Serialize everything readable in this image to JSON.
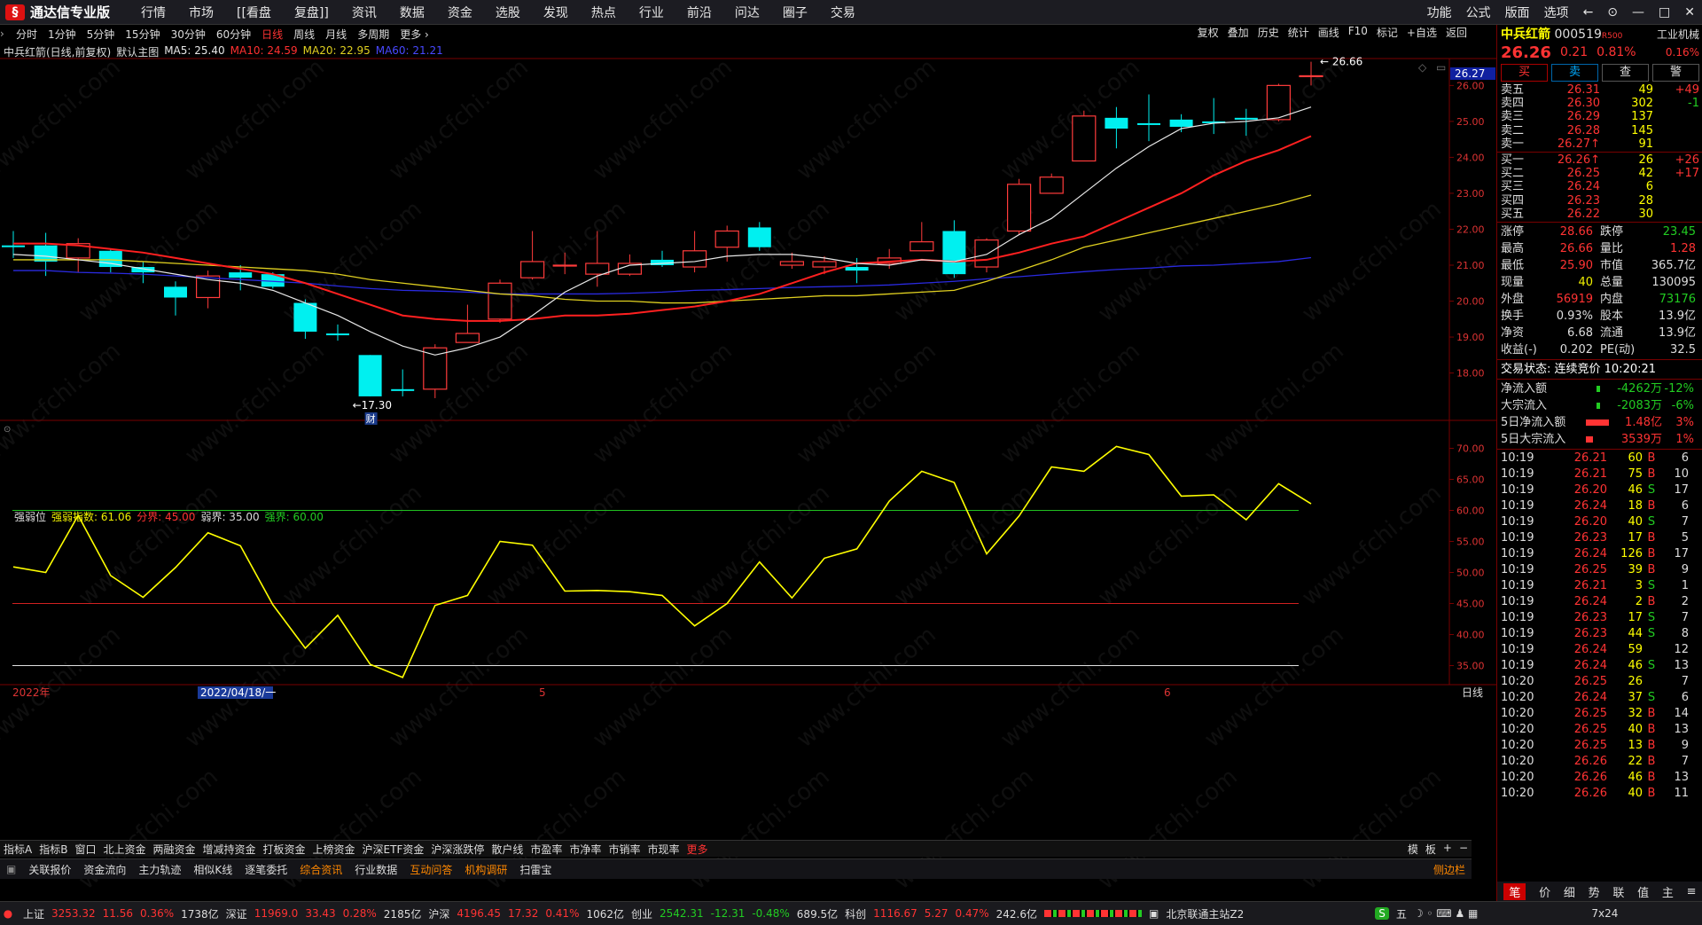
{
  "app": {
    "title": "通达信专业版"
  },
  "menu": [
    "行情",
    "市场",
    "[[看盘",
    "复盘]]",
    "资讯",
    "数据",
    "资金",
    "选股",
    "发现",
    "热点",
    "行业",
    "前沿",
    "问达",
    "圈子",
    "交易"
  ],
  "right_menu": [
    "功能",
    "公式",
    "版面",
    "选项",
    "←",
    "⊙",
    "—",
    "□",
    "✕"
  ],
  "periods": [
    "分时",
    "1分钟",
    "5分钟",
    "15分钟",
    "30分钟",
    "60分钟",
    "日线",
    "周线",
    "月线",
    "多周期",
    "更多 ›"
  ],
  "selected_period": "日线",
  "tools": [
    "复权",
    "叠加",
    "历史",
    "统计",
    "画线",
    "F10",
    "标记",
    "+自选",
    "返回"
  ],
  "ma_legend": {
    "stock": "中兵红箭(日线,前复权)",
    "main": "默认主图",
    "ma5": "MA5: 25.40",
    "ma10": "MA10: 24.59",
    "ma20": "MA20: 22.95",
    "ma60": "MA60: 21.21"
  },
  "rsi_legend": {
    "name": "强弱位",
    "val": "强弱指数: 61.06",
    "fen": "分界: 45.00",
    "ruo": "弱界: 35.00",
    "qiang": "强界: 60.00"
  },
  "colors": {
    "up": "#ff3b3b",
    "down": "#00f0f0",
    "ma5": "#e8e8e8",
    "ma10": "#ff2020",
    "ma20": "#e0d020",
    "ma60": "#2a2ae0",
    "rsi": "#ffff00"
  },
  "chart_data": [
    {
      "type": "candlestick",
      "title": "中兵红箭(日线,前复权)",
      "ylim": [
        17.2,
        26.7
      ],
      "y_ticks": [
        "26.00",
        "25.00",
        "24.00",
        "23.00",
        "22.00",
        "21.00",
        "20.00",
        "19.00",
        "18.00"
      ],
      "current_price_label": "26.27",
      "high_label": "26.66",
      "low_label": "17.30",
      "note_label": "财",
      "x_labels": [
        "2022年",
        "2022/04/18/一",
        "5",
        "6"
      ],
      "candles": [
        [
          21.55,
          21.5,
          21.95,
          21.2
        ],
        [
          21.55,
          21.1,
          21.9,
          20.7
        ],
        [
          21.2,
          21.6,
          21.75,
          20.8
        ],
        [
          21.4,
          20.95,
          21.45,
          20.8
        ],
        [
          20.95,
          20.8,
          21.1,
          20.5
        ],
        [
          20.4,
          20.1,
          20.55,
          19.6
        ],
        [
          20.1,
          20.7,
          20.85,
          19.8
        ],
        [
          20.8,
          20.65,
          21.0,
          20.3
        ],
        [
          20.75,
          20.4,
          20.8,
          20.35
        ],
        [
          19.95,
          19.15,
          20.05,
          18.95
        ],
        [
          19.1,
          19.05,
          19.35,
          18.9
        ],
        [
          18.5,
          17.35,
          18.5,
          17.35
        ],
        [
          17.55,
          17.5,
          18.1,
          17.35
        ],
        [
          17.55,
          18.7,
          18.8,
          17.3
        ],
        [
          18.85,
          19.1,
          19.9,
          18.9
        ],
        [
          19.5,
          20.5,
          20.6,
          19.4
        ],
        [
          20.65,
          21.1,
          21.95,
          20.6
        ],
        [
          21.0,
          21.0,
          21.35,
          20.75
        ],
        [
          20.75,
          21.05,
          21.95,
          20.4
        ],
        [
          20.75,
          21.05,
          21.3,
          20.7
        ],
        [
          21.15,
          21.0,
          21.4,
          20.95
        ],
        [
          20.95,
          21.4,
          21.95,
          20.8
        ],
        [
          21.5,
          21.95,
          22.1,
          21.1
        ],
        [
          22.05,
          21.5,
          22.2,
          21.4
        ],
        [
          21.0,
          21.1,
          21.35,
          20.9
        ],
        [
          20.95,
          21.1,
          21.25,
          20.75
        ],
        [
          20.95,
          20.85,
          21.2,
          20.5
        ],
        [
          21.05,
          21.2,
          21.45,
          20.9
        ],
        [
          21.4,
          21.65,
          22.2,
          21.4
        ],
        [
          21.95,
          20.75,
          22.25,
          20.65
        ],
        [
          20.95,
          21.7,
          21.75,
          20.8
        ],
        [
          21.95,
          23.25,
          23.4,
          21.85
        ],
        [
          23.0,
          23.45,
          23.55,
          23.2
        ],
        [
          23.9,
          25.15,
          25.3,
          23.9
        ],
        [
          25.1,
          24.8,
          25.4,
          24.25
        ],
        [
          24.95,
          24.9,
          25.75,
          24.45
        ],
        [
          25.05,
          24.85,
          25.2,
          24.7
        ],
        [
          25.0,
          24.95,
          25.65,
          24.65
        ],
        [
          25.1,
          25.05,
          25.35,
          24.6
        ],
        [
          25.05,
          26.0,
          26.05,
          25.0
        ],
        [
          26.26,
          26.27,
          26.66,
          26.0
        ]
      ],
      "ma5": [
        21.3,
        21.25,
        21.15,
        21.05,
        20.9,
        20.75,
        20.6,
        20.5,
        20.3,
        19.95,
        19.6,
        19.15,
        18.75,
        18.5,
        18.7,
        19.0,
        19.6,
        20.25,
        20.7,
        21.0,
        21.05,
        21.1,
        21.25,
        21.3,
        21.3,
        21.2,
        21.05,
        21.0,
        21.15,
        21.1,
        21.3,
        21.85,
        22.3,
        23.0,
        23.7,
        24.3,
        24.8,
        24.95,
        25.0,
        25.1,
        25.4
      ],
      "ma10": [
        21.6,
        21.6,
        21.55,
        21.45,
        21.35,
        21.2,
        21.05,
        20.9,
        20.75,
        20.5,
        20.2,
        19.9,
        19.6,
        19.5,
        19.45,
        19.45,
        19.5,
        19.6,
        19.6,
        19.65,
        19.75,
        19.85,
        20.0,
        20.2,
        20.5,
        20.8,
        21.05,
        21.1,
        21.15,
        21.1,
        21.15,
        21.35,
        21.6,
        21.8,
        22.2,
        22.6,
        23.0,
        23.5,
        23.9,
        24.2,
        24.59
      ],
      "ma20": [
        21.15,
        21.15,
        21.15,
        21.15,
        21.1,
        21.05,
        21.0,
        20.95,
        20.9,
        20.85,
        20.75,
        20.6,
        20.5,
        20.4,
        20.3,
        20.2,
        20.15,
        20.05,
        20.0,
        20.0,
        19.95,
        19.95,
        20.0,
        20.05,
        20.1,
        20.15,
        20.15,
        20.2,
        20.25,
        20.3,
        20.55,
        20.85,
        21.15,
        21.5,
        21.7,
        21.9,
        22.1,
        22.3,
        22.5,
        22.7,
        22.95
      ],
      "ma60": [
        20.85,
        20.85,
        20.8,
        20.78,
        20.75,
        20.7,
        20.65,
        20.6,
        20.55,
        20.5,
        20.42,
        20.35,
        20.3,
        20.28,
        20.25,
        20.2,
        20.2,
        20.2,
        20.2,
        20.22,
        20.25,
        20.3,
        20.32,
        20.35,
        20.38,
        20.4,
        20.42,
        20.45,
        20.5,
        20.55,
        20.62,
        20.68,
        20.75,
        20.82,
        20.88,
        20.92,
        20.98,
        21.0,
        21.05,
        21.1,
        21.21
      ]
    },
    {
      "type": "line",
      "title": "强弱位",
      "ylim": [
        32.5,
        72.5
      ],
      "y_ticks": [
        "70.00",
        "65.00",
        "60.00",
        "55.00",
        "50.00",
        "45.00",
        "40.00",
        "35.00"
      ],
      "levels": [
        {
          "value": 60,
          "color": "#20c020"
        },
        {
          "value": 45,
          "color": "#d02020"
        },
        {
          "value": 35,
          "color": "#e0e0e0"
        }
      ],
      "values": [
        50.9,
        50.0,
        59.2,
        49.5,
        46.0,
        50.8,
        56.4,
        54.3,
        44.8,
        37.8,
        43.1,
        35.2,
        33.1,
        44.7,
        46.3,
        55.0,
        54.4,
        47.0,
        47.1,
        46.9,
        46.3,
        41.4,
        45.0,
        51.7,
        45.9,
        52.3,
        53.8,
        61.5,
        66.3,
        64.5,
        53.0,
        59.1,
        67.0,
        66.3,
        70.3,
        69.0,
        62.3,
        62.5,
        58.5,
        64.3,
        61.06
      ]
    }
  ],
  "tab_bar1": {
    "items": [
      "指标A",
      "指标B",
      "窗口",
      "北上资金",
      "两融资金",
      "增减持资金",
      "打板资金",
      "上榜资金",
      "沪深ETF资金",
      "沪深涨跌停",
      "散户线",
      "市盈率",
      "市净率",
      "市销率",
      "市现率",
      "更多"
    ],
    "right": [
      "模",
      "板",
      "+",
      "−"
    ]
  },
  "tab_bar2": {
    "items": [
      "关联报价",
      "资金流向",
      "主力轨迹",
      "相似K线",
      "逐笔委托",
      "综合资讯",
      "行业数据",
      "互动问答",
      "机构调研",
      "扫雷宝"
    ],
    "right": "侧边栏"
  },
  "period_label": "日线",
  "quote": {
    "name": "中兵红箭",
    "code": "000519",
    "tag": "R500",
    "industry": "工业机械",
    "price": "26.26",
    "change": "0.21",
    "pct": "0.81%",
    "right_pct": "0.16%",
    "buttons": [
      "买",
      "卖",
      "查",
      "警"
    ],
    "sells": [
      [
        "卖五",
        "26.31",
        "49",
        "+49"
      ],
      [
        "卖四",
        "26.30",
        "302",
        "-1"
      ],
      [
        "卖三",
        "26.29",
        "137",
        ""
      ],
      [
        "卖二",
        "26.28",
        "145",
        ""
      ],
      [
        "卖一",
        "26.27↑",
        "91",
        ""
      ]
    ],
    "buys": [
      [
        "买一",
        "26.26↑",
        "26",
        "+26"
      ],
      [
        "买二",
        "26.25",
        "42",
        "+17"
      ],
      [
        "买三",
        "26.24",
        "6",
        ""
      ],
      [
        "买四",
        "26.23",
        "28",
        ""
      ],
      [
        "买五",
        "26.22",
        "30",
        ""
      ]
    ],
    "info": [
      [
        "涨停",
        "28.66",
        "跌停",
        "23.45"
      ],
      [
        "最高",
        "26.66",
        "量比",
        "1.28"
      ],
      [
        "最低",
        "25.90",
        "市值",
        "365.7亿"
      ],
      [
        "现量",
        "40",
        "总量",
        "130095"
      ],
      [
        "外盘",
        "56919",
        "内盘",
        "73176"
      ],
      [
        "换手",
        "0.93%",
        "股本",
        "13.9亿"
      ],
      [
        "净资",
        "6.68",
        "流通",
        "13.9亿"
      ],
      [
        "收益(-)",
        "0.202",
        "PE(动)",
        "32.5"
      ]
    ],
    "status": "交易状态: 连续竞价 10:20:21",
    "flows": [
      [
        "净流入额",
        "-4262万",
        "-12%"
      ],
      [
        "大宗流入",
        "-2083万",
        "-6%"
      ],
      [
        "5日净流入额",
        "1.48亿",
        "3%"
      ],
      [
        "5日大宗流入",
        "3539万",
        "1%"
      ]
    ],
    "ticks": [
      [
        "10:19",
        "26.21",
        "60",
        "B",
        "6"
      ],
      [
        "10:19",
        "26.21",
        "75",
        "B",
        "10"
      ],
      [
        "10:19",
        "26.20",
        "46",
        "S",
        "17"
      ],
      [
        "10:19",
        "26.24",
        "18",
        "B",
        "6"
      ],
      [
        "10:19",
        "26.20",
        "40",
        "S",
        "7"
      ],
      [
        "10:19",
        "26.23",
        "17",
        "B",
        "5"
      ],
      [
        "10:19",
        "26.24",
        "126",
        "B",
        "17"
      ],
      [
        "10:19",
        "26.25",
        "39",
        "B",
        "9"
      ],
      [
        "10:19",
        "26.21",
        "3",
        "S",
        "1"
      ],
      [
        "10:19",
        "26.24",
        "2",
        "B",
        "2"
      ],
      [
        "10:19",
        "26.23",
        "17",
        "S",
        "7"
      ],
      [
        "10:19",
        "26.23",
        "44",
        "S",
        "8"
      ],
      [
        "10:19",
        "26.24",
        "59",
        "",
        "12"
      ],
      [
        "10:19",
        "26.24",
        "46",
        "S",
        "13"
      ],
      [
        "10:20",
        "26.25",
        "26",
        "",
        "7"
      ],
      [
        "10:20",
        "26.24",
        "37",
        "S",
        "6"
      ],
      [
        "10:20",
        "26.25",
        "32",
        "B",
        "14"
      ],
      [
        "10:20",
        "26.25",
        "40",
        "B",
        "13"
      ],
      [
        "10:20",
        "26.25",
        "13",
        "B",
        "9"
      ],
      [
        "10:20",
        "26.26",
        "22",
        "B",
        "7"
      ],
      [
        "10:20",
        "26.26",
        "46",
        "B",
        "13"
      ],
      [
        "10:20",
        "26.26",
        "40",
        "B",
        "11"
      ]
    ],
    "bottom_tabs": [
      "笔",
      "价",
      "细",
      "势",
      "联",
      "值",
      "主",
      "≡"
    ]
  },
  "statusbar": {
    "sh": "上证",
    "sh_v": "3253.32",
    "sh_c": "11.56",
    "sh_p": "0.36%",
    "sh_a": "1738亿",
    "sz": "深证",
    "sz_v": "11969.0",
    "sz_c": "33.43",
    "sz_p": "0.28%",
    "sz_a": "2185亿",
    "hs": "沪深",
    "hs_v": "4196.45",
    "hs_c": "17.32",
    "hs_p": "0.41%",
    "hs_a": "1062亿",
    "cy": "创业",
    "cy_v": "2542.31",
    "cy_c": "-12.31",
    "cy_p": "-0.48%",
    "cy_a": "689.5亿",
    "kc": "科创",
    "kc_v": "1116.67",
    "kc_c": "5.27",
    "kc_p": "0.47%",
    "kc_a": "242.6亿",
    "server": "北京联通主站Z2",
    "ime": "五",
    "clock": "7x24"
  },
  "watermark": "www.cfchi.com"
}
